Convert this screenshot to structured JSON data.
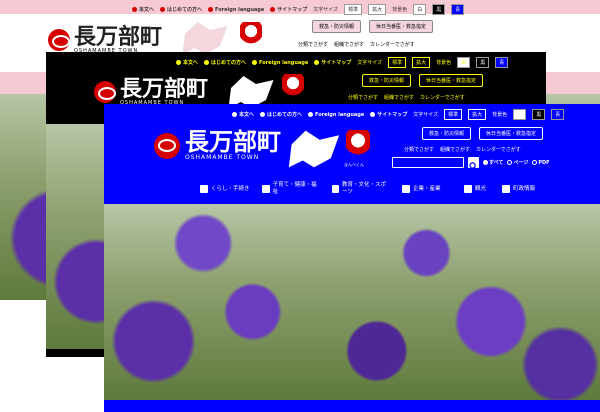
{
  "site": {
    "title": "長万部町",
    "subtitle": "OSHAMAMBE TOWN",
    "mascot_caption": "まんべくん"
  },
  "topnav": {
    "home": "本文へ",
    "first": "はじめての方へ",
    "foreign": "Foreign language",
    "sitemap": "サイトマップ",
    "textsize_label": "文字サイズ",
    "textsize_std": "標準",
    "textsize_big": "拡大",
    "bgcolor_label": "背景色",
    "bg_white": "白",
    "bg_black": "黒",
    "bg_blue": "青"
  },
  "header_buttons": {
    "emergency": "救急・防災情報",
    "holiday_clinic": "休日当番医・救急指定"
  },
  "subnav": {
    "by_field": "分類でさがす",
    "by_org": "組織でさがす",
    "by_calendar": "カレンダーでさがす"
  },
  "search": {
    "placeholder": "",
    "opt_all": "すべて",
    "opt_page": "ページ",
    "opt_pdf": "PDF"
  },
  "menu": [
    {
      "label": "くらし・手続き"
    },
    {
      "label": "子育て・健康・福祉"
    },
    {
      "label": "教育・文化・スポーツ"
    },
    {
      "label": "企業・産業"
    },
    {
      "label": "観光"
    },
    {
      "label": "町政情報"
    }
  ],
  "colors": {
    "pink": "#f7c9d3",
    "black": "#000000",
    "blue": "#0000ff",
    "accent": "#d60000"
  }
}
